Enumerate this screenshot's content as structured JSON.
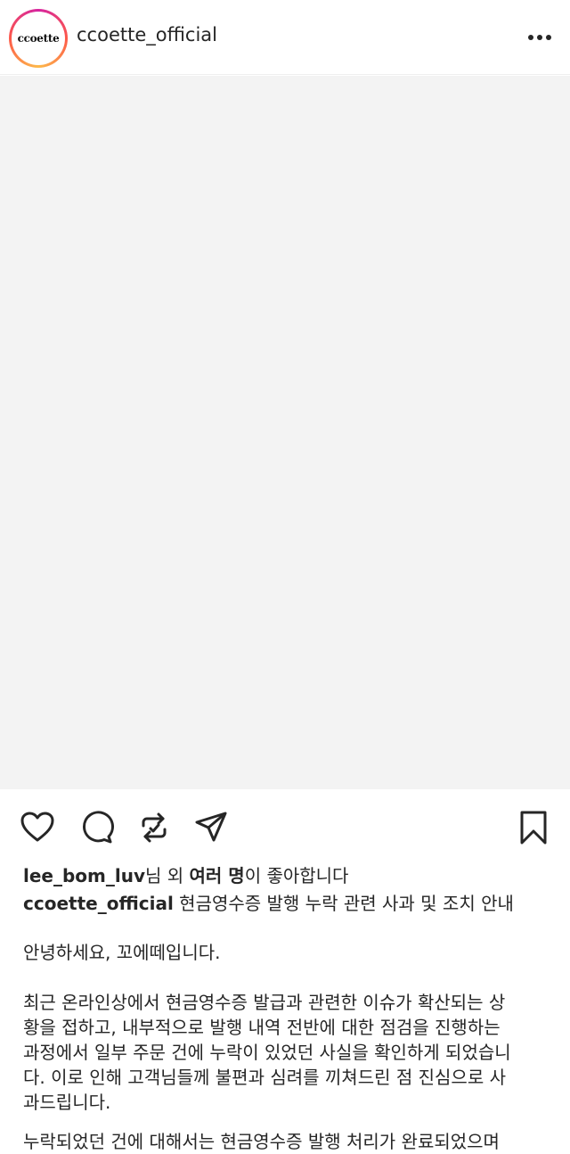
{
  "header": {
    "avatar_logo": "ccoette",
    "username": "ccoette_official",
    "more_icon": "more-horizontal-icon"
  },
  "post": {
    "image_placeholder_color": "#f3f3f3"
  },
  "actions": {
    "icons": [
      "heart-icon",
      "comment-icon",
      "repost-icon",
      "share-icon",
      "bookmark-icon"
    ]
  },
  "likes": {
    "liker": "lee_bom_luv",
    "middle": "님 외 ",
    "others": "여러 명",
    "suffix": "이 좋아합니다"
  },
  "caption": {
    "username": "ccoette_official",
    "title": " 현금영수증 발행 누락 관련 사과 및 조치 안내"
  },
  "body": {
    "greeting": "안녕하세요, 꼬에떼입니다.",
    "paragraph1_lines": [
      "최근 온라인상에서 현금영수증 발급과 관련한 이슈가 확산되는 상",
      "황을 접하고, 내부적으로 발행 내역 전반에 대한 점검을 진행하는",
      "과정에서 일부 주문 건에 누락이 있었던 사실을 확인하게 되었습니",
      "다. 이로 인해 고객님들께 불편과 심려를 끼쳐드린 점 진심으로 사",
      "과드립니다."
    ],
    "paragraph2_partial": "누락되었던 건에 대해서는 현금영수증 발행 처리가 완료되었으며"
  },
  "colors": {
    "text": "#262626",
    "ring_start": "#d6249f",
    "ring_end": "#fdb94a",
    "image_bg": "#f3f3f3"
  }
}
